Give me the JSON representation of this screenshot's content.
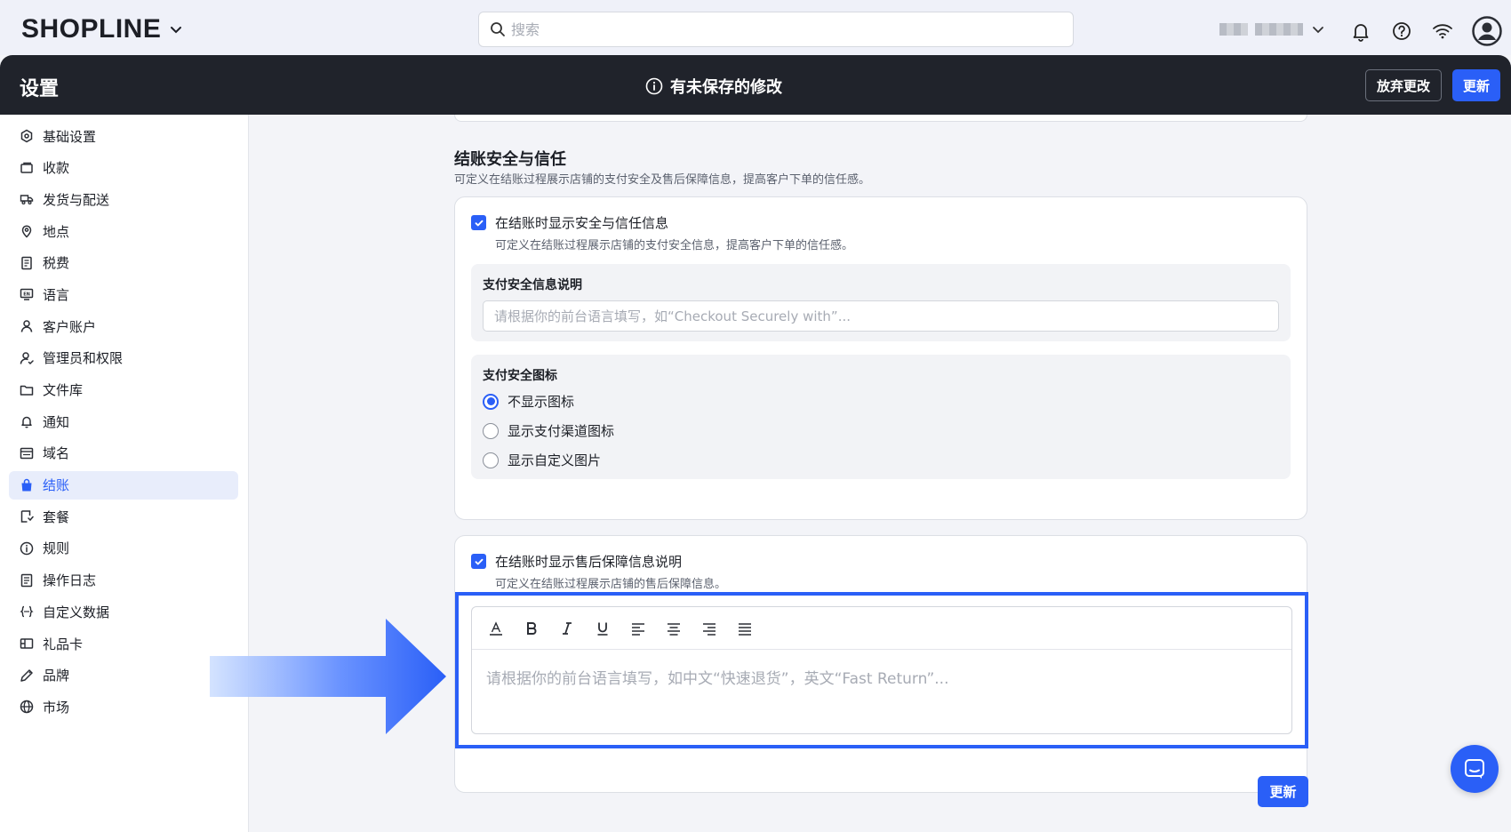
{
  "brand": {
    "logo_text": "SHOPLINE"
  },
  "search": {
    "placeholder": "搜索"
  },
  "savebar": {
    "title": "设置",
    "unsaved_message": "有未保存的修改",
    "discard_label": "放弃更改",
    "update_label": "更新"
  },
  "sidebar": {
    "items": [
      {
        "label": "基础设置",
        "icon": "settings-hex-icon"
      },
      {
        "label": "收款",
        "icon": "payment-icon"
      },
      {
        "label": "发货与配送",
        "icon": "truck-icon"
      },
      {
        "label": "地点",
        "icon": "location-pin-icon"
      },
      {
        "label": "税费",
        "icon": "tax-receipt-icon"
      },
      {
        "label": "语言",
        "icon": "language-icon"
      },
      {
        "label": "客户账户",
        "icon": "user-icon"
      },
      {
        "label": "管理员和权限",
        "icon": "user-permission-icon"
      },
      {
        "label": "文件库",
        "icon": "folder-icon"
      },
      {
        "label": "通知",
        "icon": "bell-icon"
      },
      {
        "label": "域名",
        "icon": "domain-icon"
      },
      {
        "label": "结账",
        "icon": "shopping-bag-icon",
        "active": true
      },
      {
        "label": "套餐",
        "icon": "plan-icon"
      },
      {
        "label": "规则",
        "icon": "info-icon"
      },
      {
        "label": "操作日志",
        "icon": "log-icon"
      },
      {
        "label": "自定义数据",
        "icon": "custom-data-icon"
      },
      {
        "label": "礼品卡",
        "icon": "gift-card-icon"
      },
      {
        "label": "品牌",
        "icon": "brand-icon"
      },
      {
        "label": "市场",
        "icon": "globe-icon"
      }
    ]
  },
  "main": {
    "section_title": "结账安全与信任",
    "section_desc": "可定义在结账过程展示店铺的支付安全及售后保障信息，提高客户下单的信任感。",
    "security_card": {
      "checkbox_label": "在结账时显示安全与信任信息",
      "checkbox_checked": true,
      "checkbox_desc": "可定义在结账过程展示店铺的支付安全信息，提高客户下单的信任感。",
      "info_label": "支付安全信息说明",
      "info_placeholder": "请根据你的前台语言填写，如“Checkout Securely with”...",
      "icon_label": "支付安全图标",
      "radio_options": [
        "不显示图标",
        "显示支付渠道图标",
        "显示自定义图片"
      ],
      "radio_selected": "不显示图标"
    },
    "aftersale_card": {
      "checkbox_label": "在结账时显示售后保障信息说明",
      "checkbox_checked": true,
      "checkbox_desc": "可定义在结账过程展示店铺的售后保障信息。",
      "editor_placeholder": "请根据你的前台语言填写，如中文“快速退货”，英文“Fast Return”..."
    },
    "update_label": "更新"
  },
  "colors": {
    "accent": "#2a5ff7",
    "dark_bar": "#20232b",
    "active_nav_bg": "#e8edfb"
  }
}
